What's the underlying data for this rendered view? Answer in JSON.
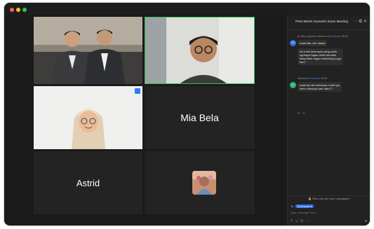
{
  "meeting": {
    "title": "PKM SMAN Sumsel's Zoom Meeting"
  },
  "participants": [
    {
      "name": ""
    },
    {
      "name": ""
    },
    {
      "name": ""
    },
    {
      "name": "Mia Bela"
    },
    {
      "name": "Astrid"
    },
    {
      "name": ""
    }
  ],
  "chat": {
    "messages": [
      {
        "initials": "AZ",
        "sender": "Ai Zahra Qeysha Ocheran",
        "to_word": "to",
        "recipient": "Everyone",
        "time": "09:53",
        "lines": [
          [
            "maaf kak, izin nanya"
          ],
          [
            "ini untuk kelompok yang udah",
            "ngumpul tugas video kemarin",
            "tetep bikin tugas individunya juga",
            "kah?"
          ]
        ],
        "avatar_color": "#2f6fe8"
      },
      {
        "initials": "K",
        "sender": "Kalisha",
        "to_word": "to",
        "recipient": "Everyone",
        "time": "09:54",
        "lines": [
          [
            "maaf ibu izin bertanya, boleh ga",
            "kirim videonya hari rabu??"
          ]
        ],
        "avatar_color": "#2bb673"
      }
    ],
    "privacy_text": "Who can see your messages?",
    "to_label": "To:",
    "recipient_selected": "Everyone",
    "input_placeholder": "Type message here..."
  },
  "colors": {
    "active_speaker_border": "#31c25a",
    "accent": "#2f6fe8"
  }
}
